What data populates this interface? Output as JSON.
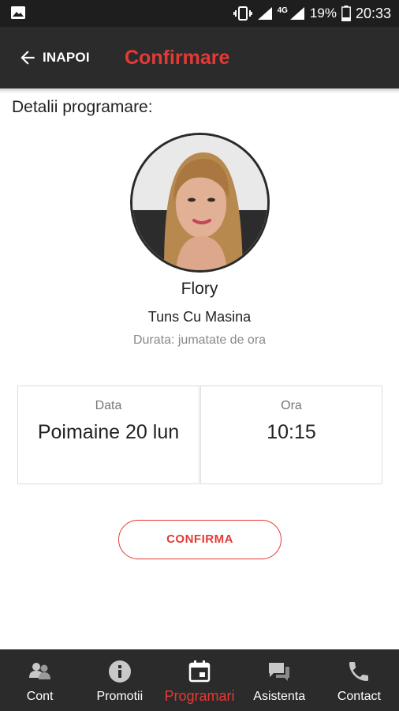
{
  "status_bar": {
    "network": "4G",
    "battery": "19%",
    "time": "20:33"
  },
  "app_bar": {
    "back_label": "INAPOI",
    "title": "Confirmare"
  },
  "section_title": "Detalii programare:",
  "stylist": {
    "name": "Flory",
    "service": "Tuns Cu Masina",
    "duration": "Durata: jumatate de ora"
  },
  "appointment": {
    "date_caption": "Data",
    "date_value": "Poimaine 20 lun",
    "time_caption": "Ora",
    "time_value": "10:15"
  },
  "confirm_label": "CONFIRMA",
  "bottom_nav": {
    "items": [
      {
        "label": "Cont",
        "icon": "people-icon"
      },
      {
        "label": "Promotii",
        "icon": "info-icon"
      },
      {
        "label": "Programari",
        "icon": "calendar-icon"
      },
      {
        "label": "Asistenta",
        "icon": "chat-icon"
      },
      {
        "label": "Contact",
        "icon": "phone-icon"
      }
    ],
    "active_index": 2
  },
  "colors": {
    "accent": "#e53935",
    "bar_background": "#2b2b2b",
    "status_background": "#1e1e1e"
  }
}
